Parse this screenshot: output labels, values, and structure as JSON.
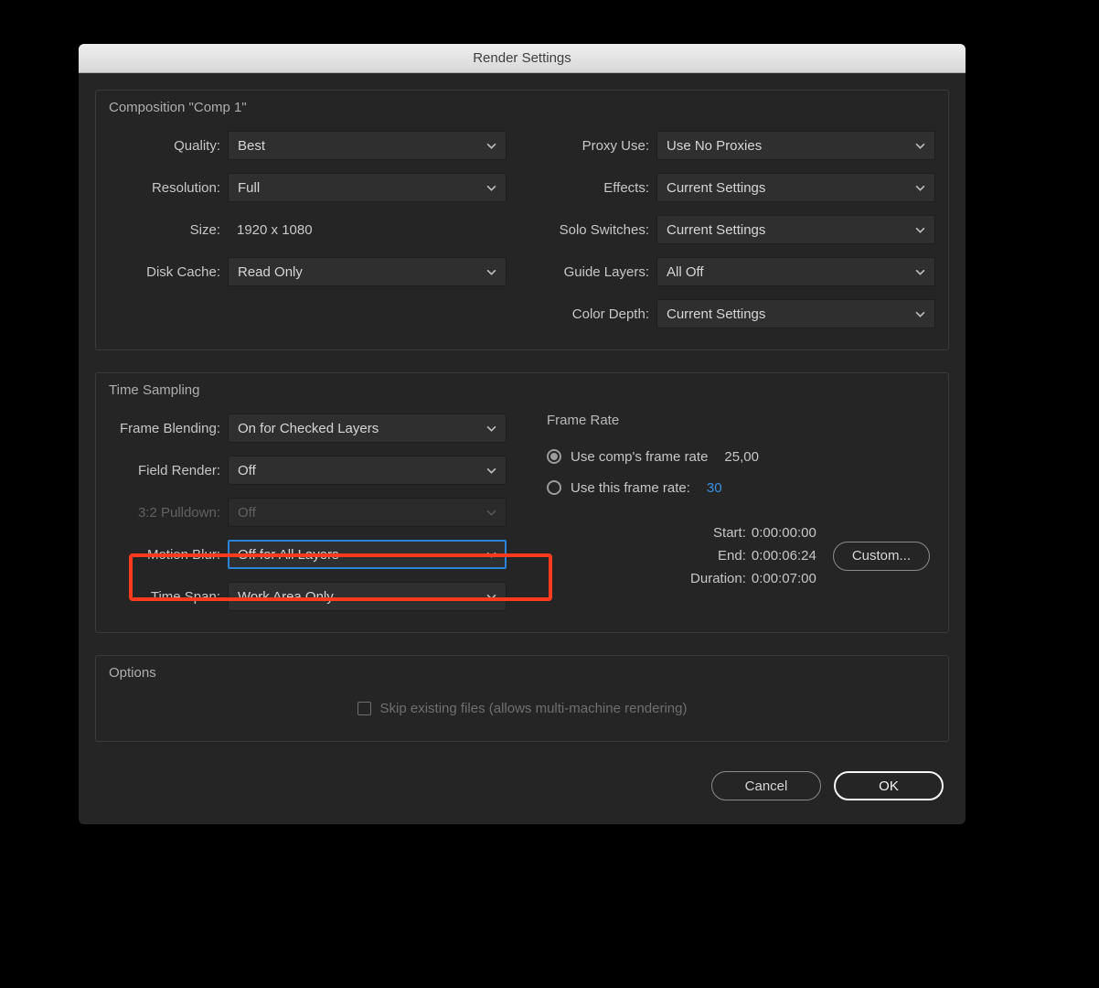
{
  "dialog": {
    "title": "Render Settings"
  },
  "composition": {
    "group_title": "Composition \"Comp 1\"",
    "quality": {
      "label": "Quality:",
      "value": "Best"
    },
    "resolution": {
      "label": "Resolution:",
      "value": "Full"
    },
    "size": {
      "label": "Size:",
      "value": "1920 x 1080"
    },
    "disk_cache": {
      "label": "Disk Cache:",
      "value": "Read Only"
    },
    "proxy_use": {
      "label": "Proxy Use:",
      "value": "Use No Proxies"
    },
    "effects": {
      "label": "Effects:",
      "value": "Current Settings"
    },
    "solo_switches": {
      "label": "Solo Switches:",
      "value": "Current Settings"
    },
    "guide_layers": {
      "label": "Guide Layers:",
      "value": "All Off"
    },
    "color_depth": {
      "label": "Color Depth:",
      "value": "Current Settings"
    }
  },
  "time_sampling": {
    "group_title": "Time Sampling",
    "frame_blending": {
      "label": "Frame Blending:",
      "value": "On for Checked Layers"
    },
    "field_render": {
      "label": "Field Render:",
      "value": "Off"
    },
    "pulldown": {
      "label": "3:2 Pulldown:",
      "value": "Off"
    },
    "motion_blur": {
      "label": "Motion Blur:",
      "value": "Off for All Layers"
    },
    "time_span": {
      "label": "Time Span:",
      "value": "Work Area Only"
    },
    "frame_rate": {
      "title": "Frame Rate",
      "use_comp_label": "Use comp's frame rate",
      "use_comp_value": "25,00",
      "use_this_label": "Use this frame rate:",
      "use_this_value": "30"
    },
    "times": {
      "start_label": "Start:",
      "start_value": "0:00:00:00",
      "end_label": "End:",
      "end_value": "0:00:06:24",
      "duration_label": "Duration:",
      "duration_value": "0:00:07:00",
      "custom_label": "Custom..."
    }
  },
  "options": {
    "group_title": "Options",
    "skip_label": "Skip existing files (allows multi-machine rendering)"
  },
  "footer": {
    "cancel": "Cancel",
    "ok": "OK"
  }
}
